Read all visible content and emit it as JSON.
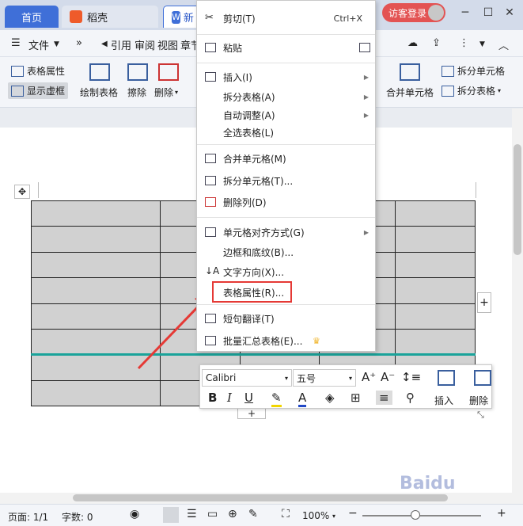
{
  "tabs": [
    {
      "label": "首页"
    },
    {
      "label": "稻壳"
    },
    {
      "label": "新"
    }
  ],
  "login": "访客登录",
  "menubar": {
    "file": "文件",
    "items": [
      "引用",
      "审阅",
      "视图",
      "章节"
    ]
  },
  "ribbon": {
    "table_props": "表格属性",
    "show_grid": "显示虚框",
    "draw_table": "绘制表格",
    "eraser": "擦除",
    "delete": "删除",
    "merge_cells": "合并单元格",
    "split_cells": "拆分单元格",
    "split_table": "拆分表格"
  },
  "context_menu": [
    {
      "label": "剪切(T)",
      "shortcut": "Ctrl+X"
    },
    {
      "label": "粘贴"
    },
    {
      "label": "插入(I)"
    },
    {
      "label": "拆分表格(A)"
    },
    {
      "label": "自动调整(A)"
    },
    {
      "label": "全选表格(L)"
    },
    {
      "label": "合并单元格(M)"
    },
    {
      "label": "拆分单元格(T)..."
    },
    {
      "label": "删除列(D)"
    },
    {
      "label": "单元格对齐方式(G)"
    },
    {
      "label": "边框和底纹(B)..."
    },
    {
      "label": "文字方向(X)..."
    },
    {
      "label": "表格属性(R)..."
    },
    {
      "label": "短句翻译(T)"
    },
    {
      "label": "批量汇总表格(E)..."
    }
  ],
  "mini_toolbar": {
    "font": "Calibri",
    "size": "五号",
    "insert": "插入",
    "delete": "删除"
  },
  "status": {
    "page": "页面: 1/1",
    "words": "字数: 0",
    "zoom": "100%"
  },
  "colors": {
    "accent": "#3f6fd8",
    "highlight": "#e53935",
    "table_fill": "#d1d1d1"
  }
}
